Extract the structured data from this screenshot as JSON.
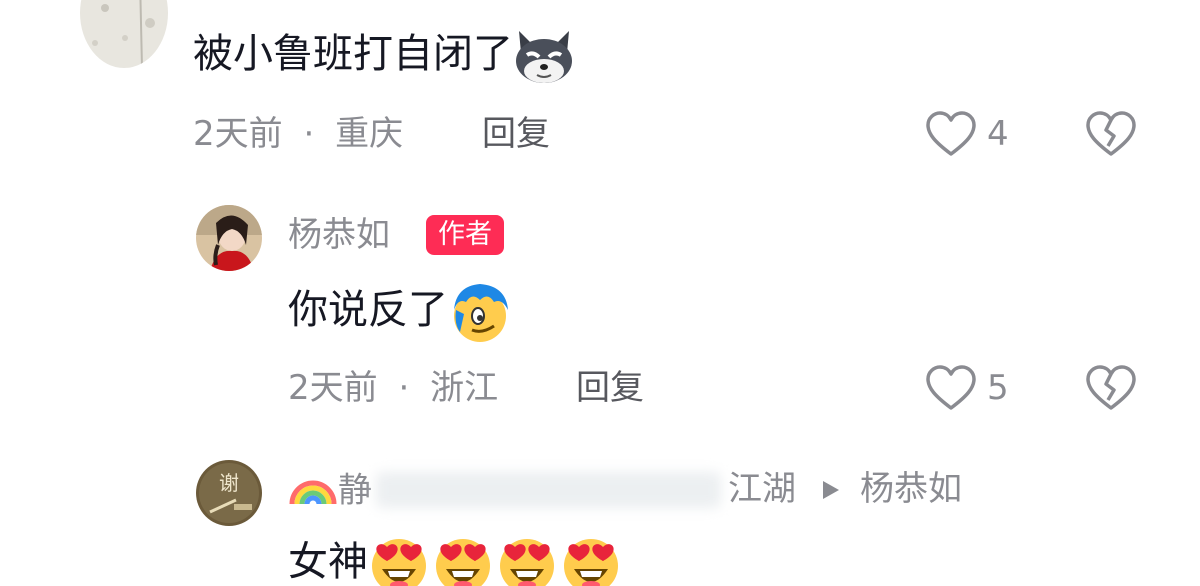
{
  "comments": [
    {
      "text": "被小鲁班打自闭了",
      "emoji": "husky-face-emoji",
      "time": "2天前",
      "location": "重庆",
      "reply_label": "回复",
      "likes": "4"
    }
  ],
  "reply": {
    "username": "杨恭如",
    "badge": "作者",
    "text": "你说反了",
    "emoji": "blue-hair-smirk-emoji",
    "time": "2天前",
    "location": "浙江",
    "reply_label": "回复",
    "likes": "5"
  },
  "reply2": {
    "username_visible_start": "静",
    "username_visible_end": "江湖",
    "reply_to": "杨恭如",
    "text": "女神",
    "emoji": "heart-eyes-emoji",
    "emoji_count": 4
  },
  "separator": "·",
  "colors": {
    "text": "#161823",
    "meta": "#8a8b91",
    "badge": "#fe2c55"
  }
}
